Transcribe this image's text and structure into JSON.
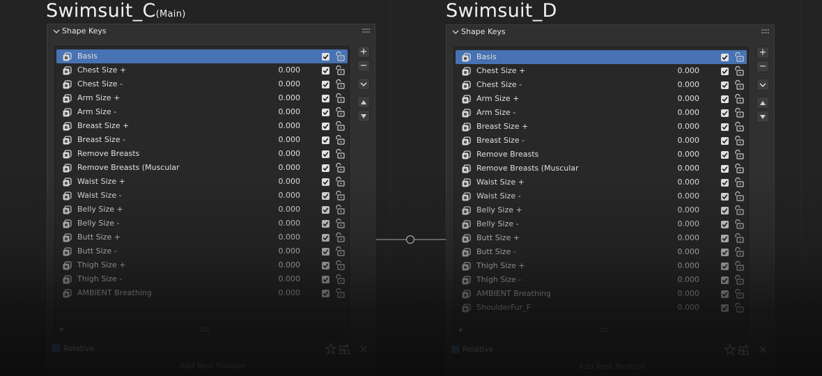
{
  "left": {
    "title": "Swimsuit_C",
    "title_suffix": "(Main)",
    "panel_title": "Shape Keys",
    "keys": [
      {
        "name": "Basis",
        "value": ""
      },
      {
        "name": "Chest Size +",
        "value": "0.000"
      },
      {
        "name": "Chest Size -",
        "value": "0.000"
      },
      {
        "name": "Arm Size +",
        "value": "0.000"
      },
      {
        "name": "Arm Size -",
        "value": "0.000"
      },
      {
        "name": "Breast Size +",
        "value": "0.000"
      },
      {
        "name": "Breast Size -",
        "value": "0.000"
      },
      {
        "name": "Remove Breasts",
        "value": "0.000"
      },
      {
        "name": "Remove Breasts (Muscular",
        "value": "0.000"
      },
      {
        "name": "Waist Size +",
        "value": "0.000"
      },
      {
        "name": "Waist Size -",
        "value": "0.000"
      },
      {
        "name": "Belly Size +",
        "value": "0.000"
      },
      {
        "name": "Belly Size -",
        "value": "0.000"
      },
      {
        "name": "Butt Size +",
        "value": "0.000"
      },
      {
        "name": "Butt Size -",
        "value": "0.000"
      },
      {
        "name": "Thigh Size +",
        "value": "0.000"
      },
      {
        "name": "Thigh Size -",
        "value": "0.000"
      },
      {
        "name": "AMBIENT Breathing",
        "value": "0.000"
      }
    ],
    "relative_label": "Relative",
    "add_rest_label": "Add Rest Position"
  },
  "right": {
    "title": "Swimsuit_D",
    "title_suffix": "",
    "panel_title": "Shape Keys",
    "keys": [
      {
        "name": "Basis",
        "value": ""
      },
      {
        "name": "Chest Size +",
        "value": "0.000"
      },
      {
        "name": "Chest Size -",
        "value": "0.000"
      },
      {
        "name": "Arm Size +",
        "value": "0.000"
      },
      {
        "name": "Arm Size -",
        "value": "0.000"
      },
      {
        "name": "Breast Size +",
        "value": "0.000"
      },
      {
        "name": "Breast Size -",
        "value": "0.000"
      },
      {
        "name": "Remove Breasts",
        "value": "0.000"
      },
      {
        "name": "Remove Breasts (Muscular",
        "value": "0.000"
      },
      {
        "name": "Waist Size +",
        "value": "0.000"
      },
      {
        "name": "Waist Size -",
        "value": "0.000"
      },
      {
        "name": "Belly Size +",
        "value": "0.000"
      },
      {
        "name": "Belly Size -",
        "value": "0.000"
      },
      {
        "name": "Butt Size +",
        "value": "0.000"
      },
      {
        "name": "Butt Size -",
        "value": "0.000"
      },
      {
        "name": "Thigh Size +",
        "value": "0.000"
      },
      {
        "name": "Thigh Size -",
        "value": "0.000"
      },
      {
        "name": "AMBIENT Breathing",
        "value": "0.000"
      },
      {
        "name": "ShoulderFur_F",
        "value": "0.000"
      }
    ],
    "relative_label": "Relative",
    "add_rest_label": "Add Rest Position"
  },
  "buttons": {
    "add": "+",
    "remove": "−"
  },
  "icons": {
    "collapse": "chevron-down-icon",
    "key": "shape-key-icon",
    "mute": "checkbox-icon",
    "lock": "lock-icon",
    "specials": "chevron-down-icon",
    "move_up": "triangle-up-icon",
    "move_down": "triangle-down-icon",
    "pin": "star-icon",
    "new_from_mix": "grid-add-icon",
    "clear": "close-icon"
  },
  "colors": {
    "selected_row": "#4772b3",
    "panel_bg": "#303030",
    "list_bg": "#282828"
  }
}
